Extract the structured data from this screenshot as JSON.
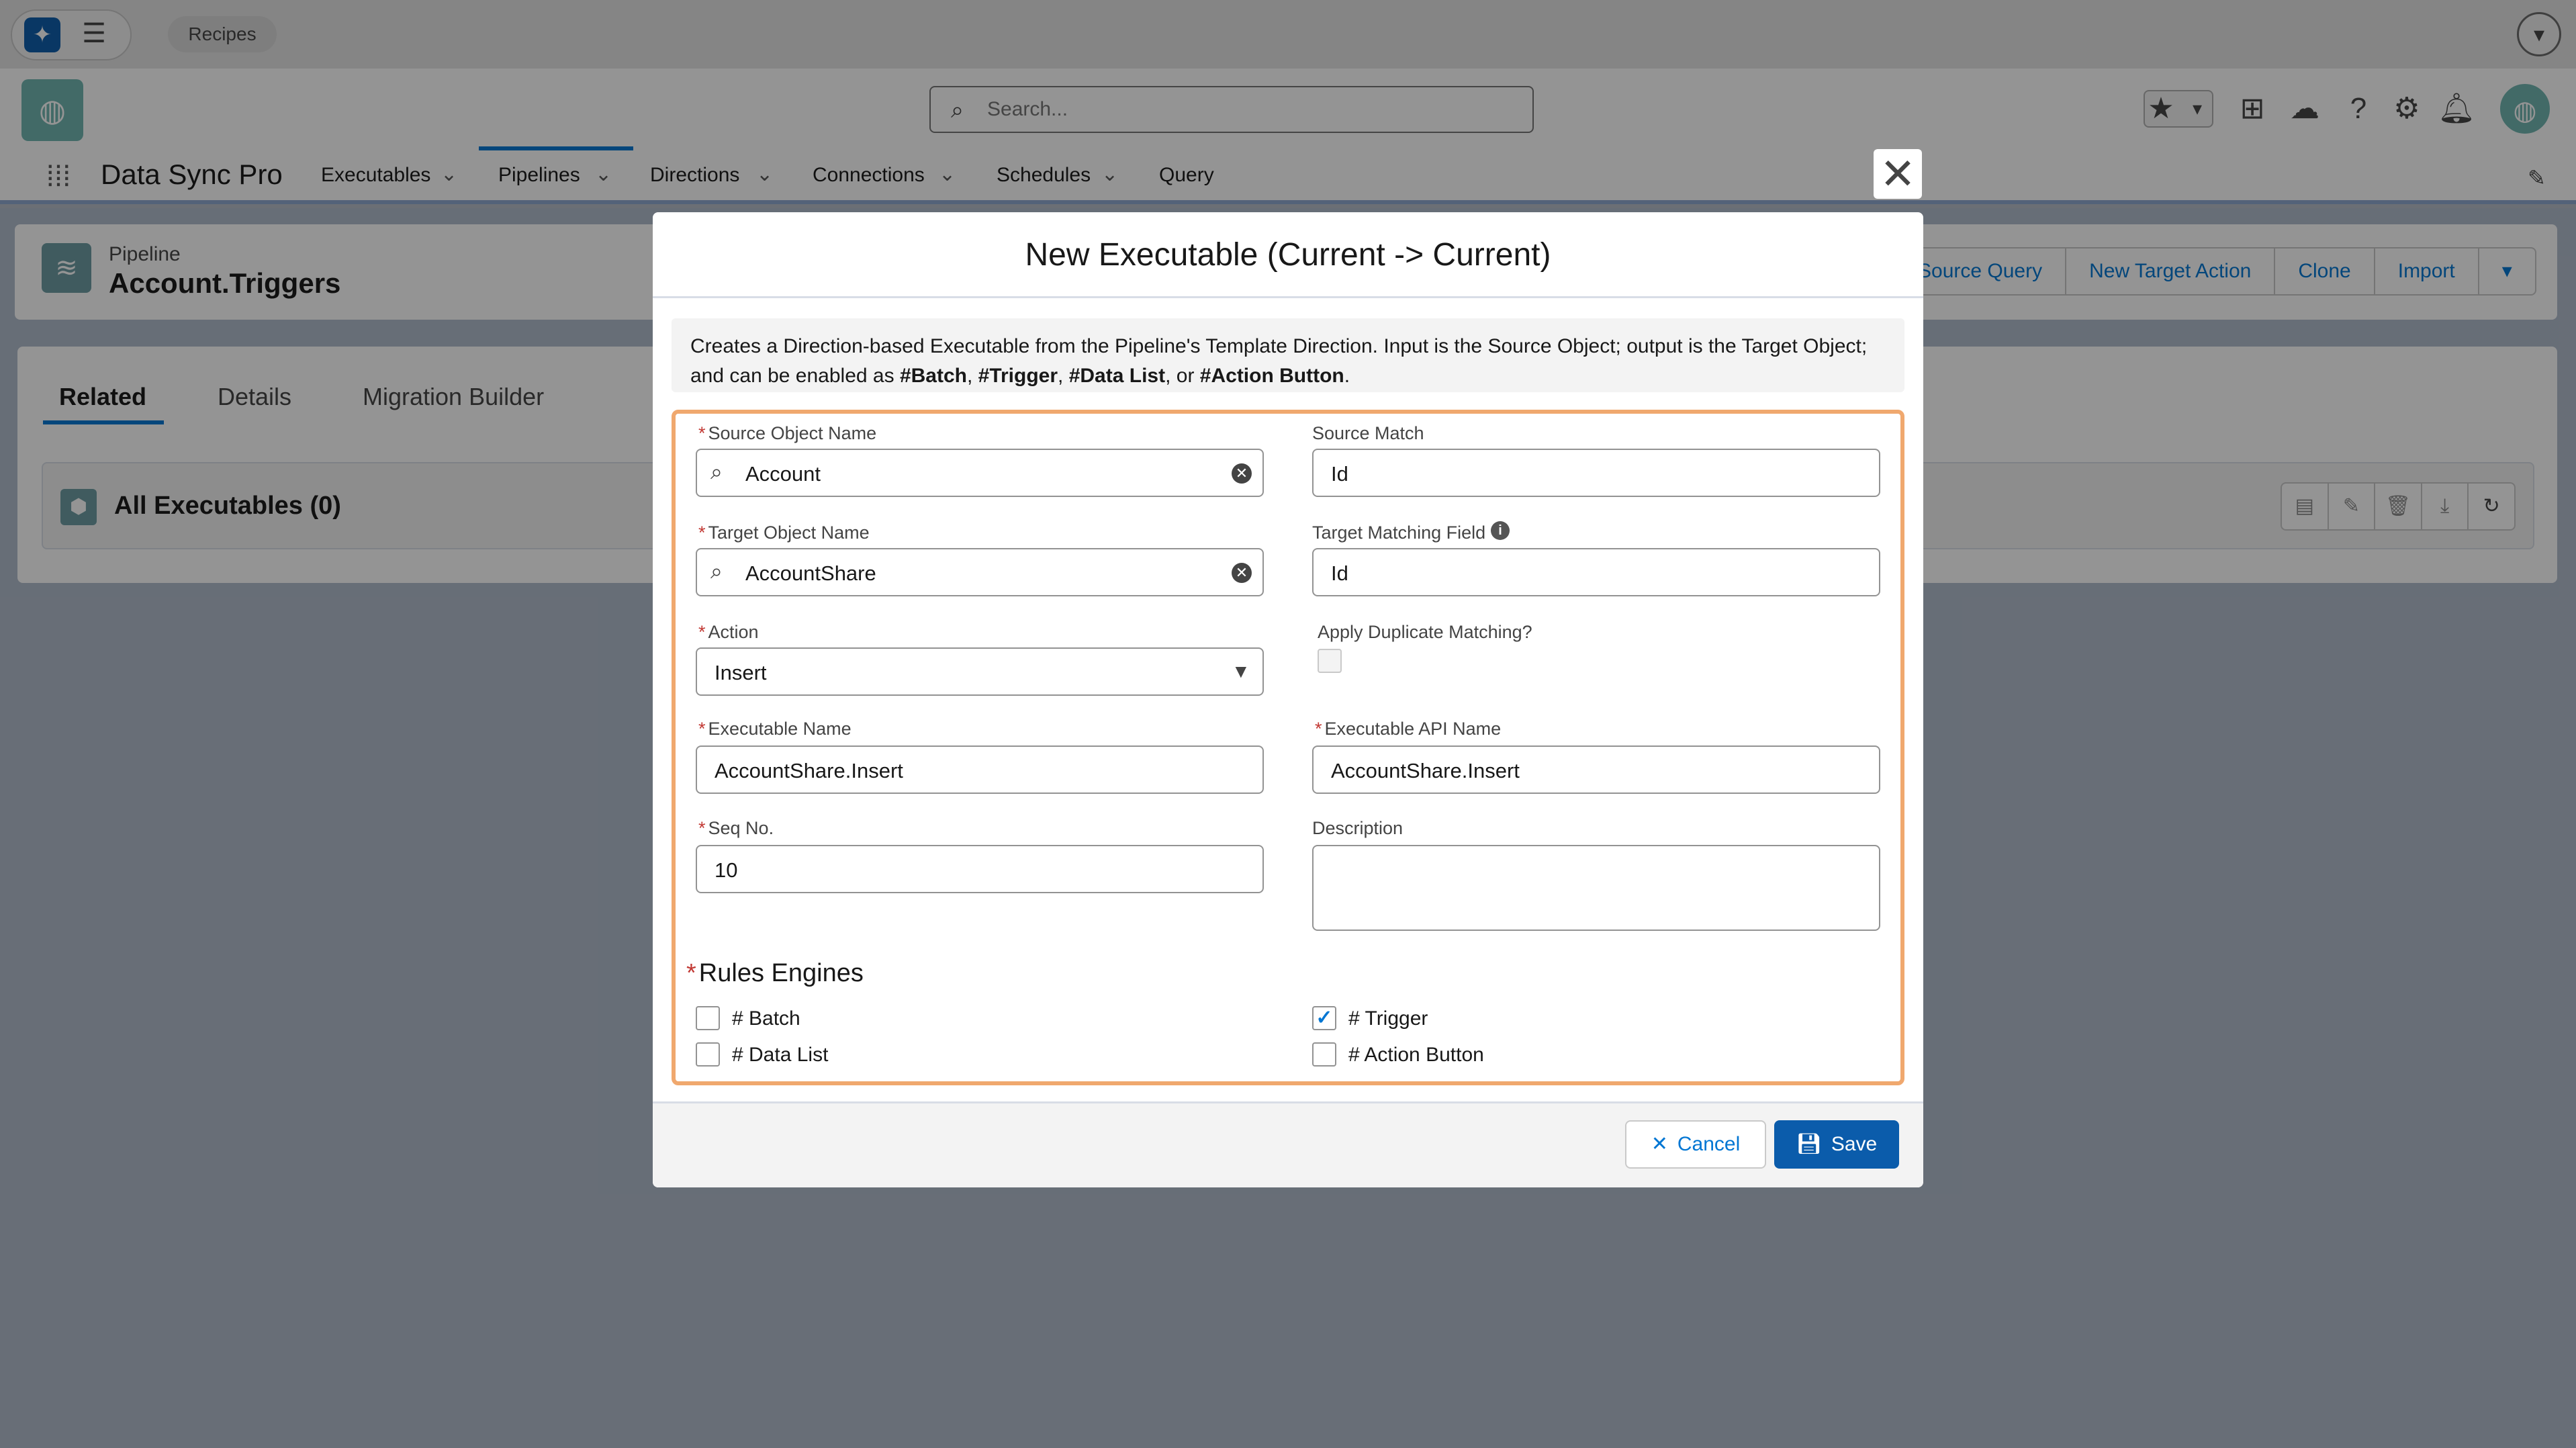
{
  "topbar": {
    "recipes_label": "Recipes",
    "launcher_icon": "sparkle-icon",
    "menu_icon": "hamburger-icon"
  },
  "header": {
    "search_placeholder": "Search...",
    "icons": [
      "favorites-star-icon",
      "add-icon",
      "trailhead-icon",
      "help-icon",
      "setup-gear-icon",
      "bell-icon"
    ]
  },
  "nav": {
    "app_name": "Data Sync Pro",
    "tabs": [
      {
        "label": "Executables",
        "has_menu": true
      },
      {
        "label": "Pipelines",
        "has_menu": true,
        "active": true
      },
      {
        "label": "Directions",
        "has_menu": true
      },
      {
        "label": "Connections",
        "has_menu": true
      },
      {
        "label": "Schedules",
        "has_menu": true
      },
      {
        "label": "Query",
        "has_menu": false
      }
    ]
  },
  "record": {
    "type": "Pipeline",
    "title": "Account.Triggers",
    "actions": [
      "Source Query",
      "New Target Action",
      "Clone",
      "Import"
    ]
  },
  "subtabs": {
    "items": [
      "Related",
      "Details",
      "Migration Builder"
    ],
    "active": "Related"
  },
  "related": {
    "title": "All Executables (0)"
  },
  "modal": {
    "title": "New Executable (Current -> Current)",
    "info_prefix": "Creates a Direction-based Executable from the Pipeline's Template Direction. Input is the Source Object; output is the Target Object; and can be enabled as ",
    "info_tags": [
      "#Batch",
      "#Trigger",
      "#Data List",
      "#Action Button"
    ],
    "info_sep1": ", ",
    "info_sep2": ", ",
    "info_sep3": ", or ",
    "info_end": ".",
    "fields": {
      "source_object_name": {
        "label": "Source Object Name",
        "value": "Account",
        "required": true
      },
      "source_match": {
        "label": "Source Match",
        "value": "Id"
      },
      "target_object_name": {
        "label": "Target Object Name",
        "value": "AccountShare",
        "required": true
      },
      "target_matching_field": {
        "label": "Target Matching Field",
        "value": "Id"
      },
      "action": {
        "label": "Action",
        "value": "Insert",
        "required": true
      },
      "apply_duplicate_matching": {
        "label": "Apply Duplicate Matching?",
        "checked": false
      },
      "executable_name": {
        "label": "Executable Name",
        "value": "AccountShare.Insert",
        "required": true
      },
      "executable_api_name": {
        "label": "Executable API Name",
        "value": "AccountShare.Insert",
        "required": true
      },
      "seq_no": {
        "label": "Seq No.",
        "value": "10",
        "required": true
      },
      "description": {
        "label": "Description",
        "value": ""
      }
    },
    "rules_engines": {
      "title": "Rules Engines",
      "options": [
        {
          "label": "# Batch",
          "checked": false
        },
        {
          "label": "# Trigger",
          "checked": true
        },
        {
          "label": "# Data List",
          "checked": false
        },
        {
          "label": "# Action Button",
          "checked": false
        }
      ]
    },
    "footer": {
      "cancel_label": "Cancel",
      "save_label": "Save"
    }
  }
}
